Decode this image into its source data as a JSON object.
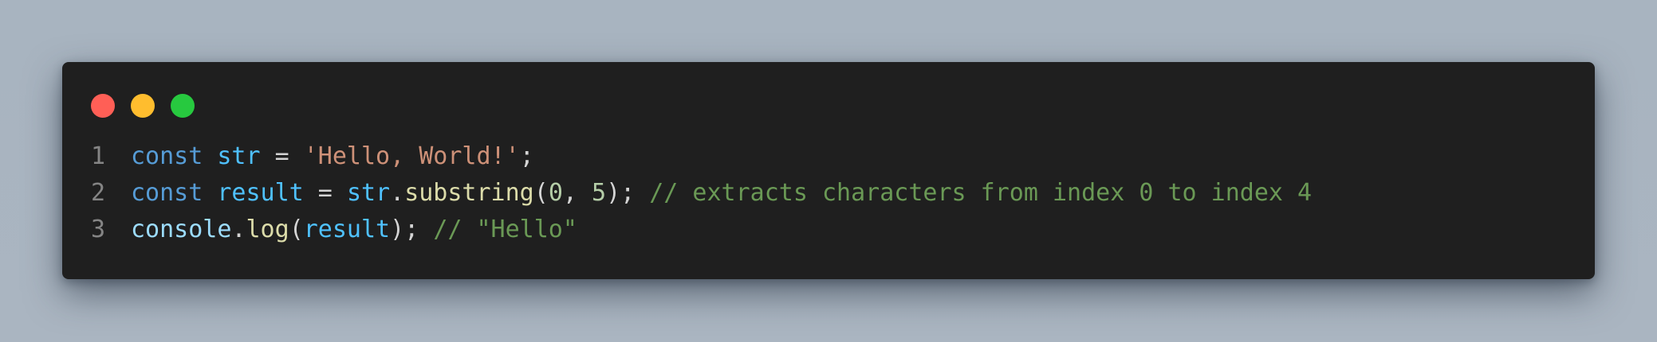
{
  "window": {
    "controls": {
      "close_color": "#ff5f56",
      "minimize_color": "#ffbd2e",
      "maximize_color": "#27c93f"
    }
  },
  "code": {
    "lines": [
      {
        "number": "1",
        "tokens": [
          {
            "text": "const",
            "type": "kw"
          },
          {
            "text": " ",
            "type": "plain"
          },
          {
            "text": "str",
            "type": "var"
          },
          {
            "text": " = ",
            "type": "plain"
          },
          {
            "text": "'Hello, World!'",
            "type": "str"
          },
          {
            "text": ";",
            "type": "plain"
          }
        ]
      },
      {
        "number": "2",
        "tokens": [
          {
            "text": "const",
            "type": "kw"
          },
          {
            "text": " ",
            "type": "plain"
          },
          {
            "text": "result",
            "type": "var"
          },
          {
            "text": " = ",
            "type": "plain"
          },
          {
            "text": "str",
            "type": "var"
          },
          {
            "text": ".",
            "type": "plain"
          },
          {
            "text": "substring",
            "type": "fn"
          },
          {
            "text": "(",
            "type": "plain"
          },
          {
            "text": "0",
            "type": "num"
          },
          {
            "text": ", ",
            "type": "plain"
          },
          {
            "text": "5",
            "type": "num"
          },
          {
            "text": "); ",
            "type": "plain"
          },
          {
            "text": "// extracts characters from index 0 to index 4",
            "type": "cmt"
          }
        ]
      },
      {
        "number": "3",
        "tokens": [
          {
            "text": "console",
            "type": "lightvar"
          },
          {
            "text": ".",
            "type": "plain"
          },
          {
            "text": "log",
            "type": "fn"
          },
          {
            "text": "(",
            "type": "plain"
          },
          {
            "text": "result",
            "type": "var"
          },
          {
            "text": "); ",
            "type": "plain"
          },
          {
            "text": "// \"Hello\"",
            "type": "cmt"
          }
        ]
      }
    ]
  },
  "colors": {
    "background": "#a9b5c1",
    "editor_bg": "#1f1f1f",
    "keyword": "#569cd6",
    "variable": "#4fc1ff",
    "string": "#ce9178",
    "function": "#dcdcaa",
    "number": "#b5cea8",
    "comment": "#6a9955",
    "line_number": "#858585"
  }
}
